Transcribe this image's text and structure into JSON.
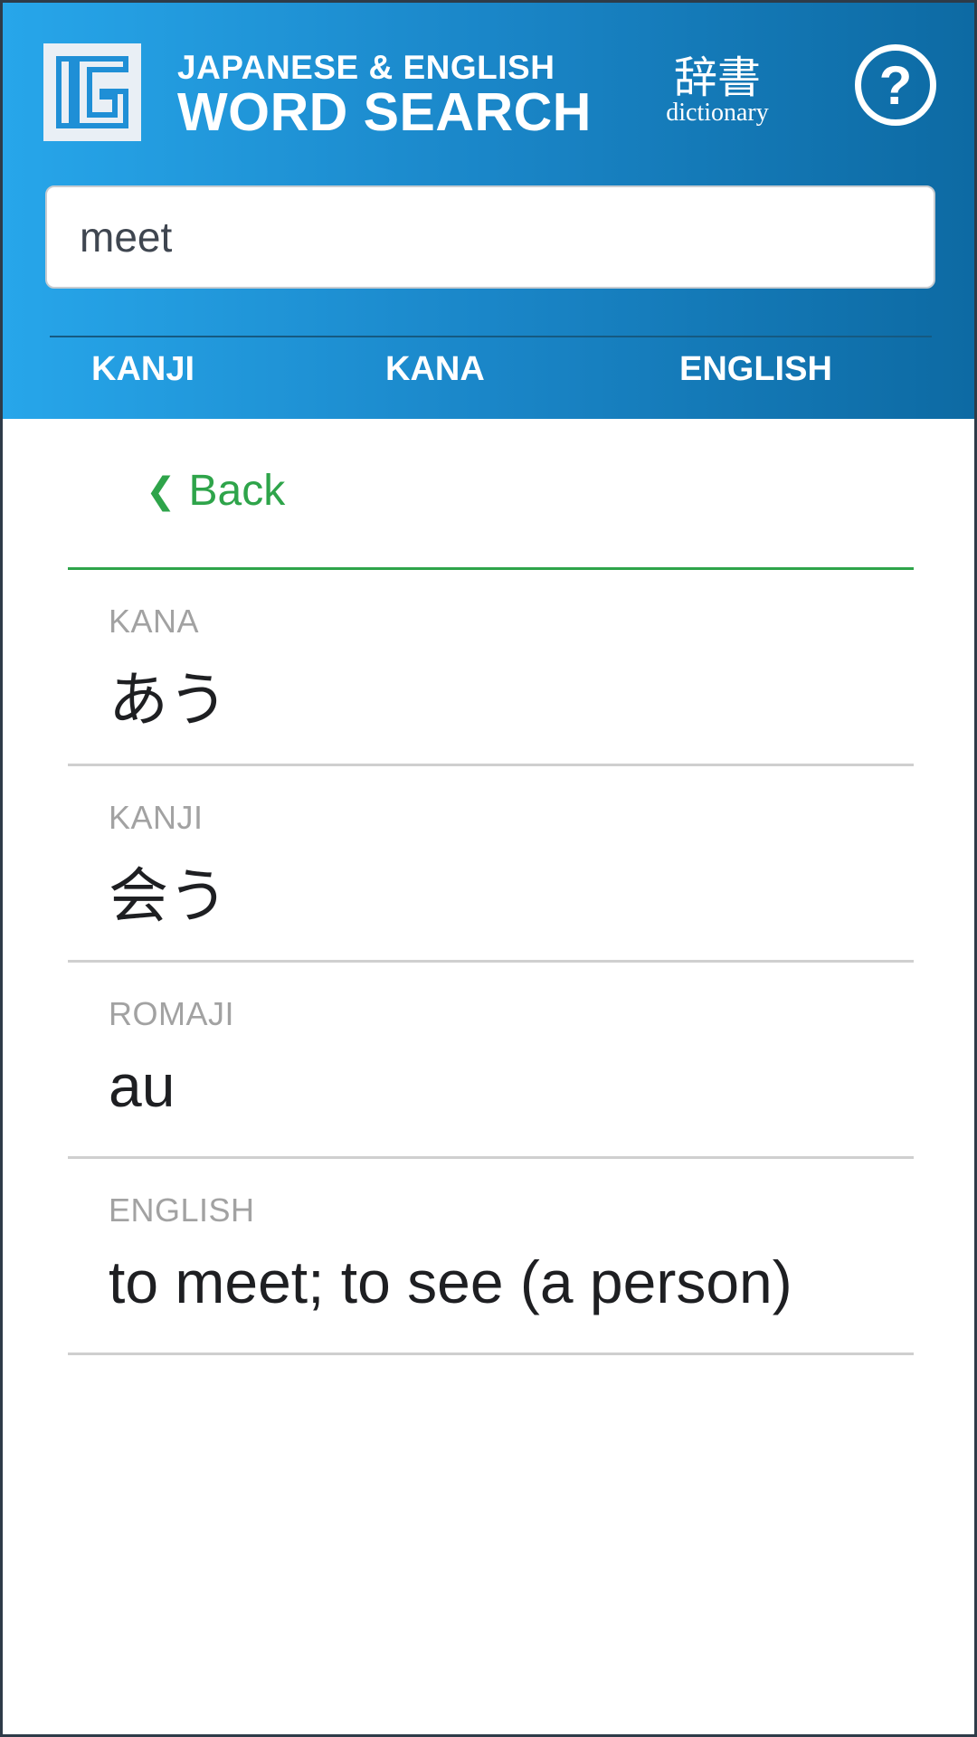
{
  "header": {
    "title_small": "JAPANESE & ENGLISH",
    "title_big": "WORD SEARCH",
    "dictionary_jp": "辞書",
    "dictionary_en": "dictionary",
    "help_symbol": "?",
    "logo_icon": "word-search-logo-icon",
    "help_icon": "question-circle-icon"
  },
  "search": {
    "value": "meet"
  },
  "tabs": [
    {
      "label": "KANJI"
    },
    {
      "label": "KANA"
    },
    {
      "label": "ENGLISH"
    }
  ],
  "back": {
    "chevron": "❮",
    "label": "Back"
  },
  "entries": [
    {
      "label": "KANA",
      "value": "あう"
    },
    {
      "label": "KANJI",
      "value": "会う"
    },
    {
      "label": "ROMAJI",
      "value": "au"
    },
    {
      "label": "ENGLISH",
      "value": "to meet; to see (a person)"
    }
  ],
  "colors": {
    "header_gradient_start": "#27a6ea",
    "header_gradient_end": "#0d6aa3",
    "accent_green": "#2ea44a",
    "label_gray": "#a2a2a2",
    "divider_gray": "#cfcfcf"
  }
}
